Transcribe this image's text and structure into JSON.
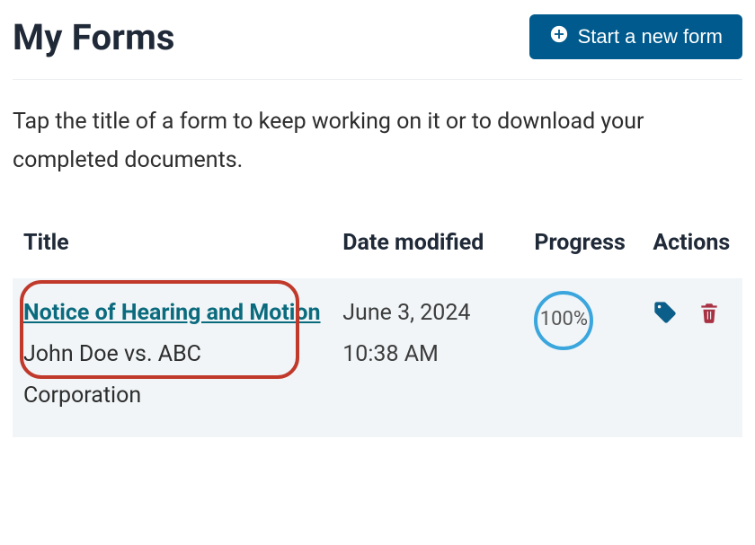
{
  "header": {
    "title": "My Forms",
    "start_button_label": "Start a new form"
  },
  "instructions": "Tap the title of a form to keep working on it or to download your completed documents.",
  "table": {
    "headers": {
      "title": "Title",
      "date_modified": "Date modified",
      "progress": "Progress",
      "actions": "Actions"
    },
    "rows": [
      {
        "form_title": "Notice of Hearing and Motion",
        "case_label": "John Doe vs. ABC Corporation",
        "date_modified": "June 3, 2024 10:38 AM",
        "progress": "100%"
      }
    ]
  }
}
